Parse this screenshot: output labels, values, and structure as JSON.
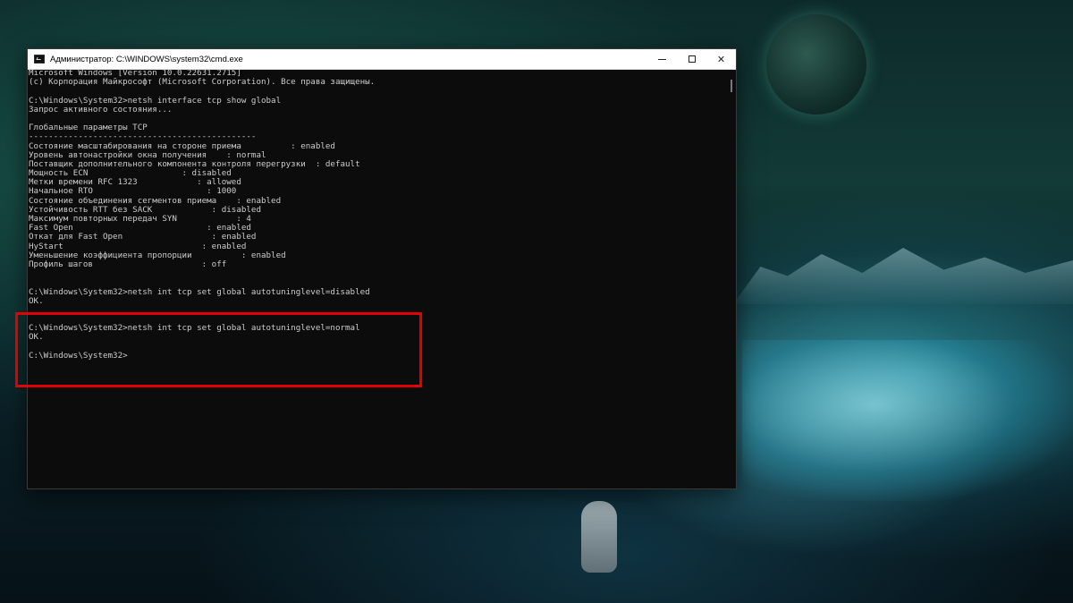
{
  "window": {
    "title": "Администратор: C:\\WINDOWS\\system32\\cmd.exe",
    "controls": {
      "minimize": "minimize",
      "maximize": "maximize",
      "close": "✕"
    }
  },
  "console": {
    "lines": [
      "Microsoft Windows [Version 10.0.22631.2715]",
      "(c) Корпорация Майкрософт (Microsoft Corporation). Все права защищены.",
      "",
      "C:\\Windows\\System32>netsh interface tcp show global",
      "Запрос активного состояния...",
      "",
      "Глобальные параметры TCP",
      "----------------------------------------------",
      "Состояние масштабирования на стороне приема          : enabled",
      "Уровень автонастройки окна получения    : normal",
      "Поставщик дополнительного компонента контроля перегрузки  : default",
      "Мощность ECN                   : disabled",
      "Метки времени RFC 1323            : allowed",
      "Начальное RTO                       : 1000",
      "Состояние объединения сегментов приема    : enabled",
      "Устойчивость RTT без SACK            : disabled",
      "Максимум повторных передач SYN            : 4",
      "Fast Open                           : enabled",
      "Откат для Fast Open                  : enabled",
      "HyStart                            : enabled",
      "Уменьшение коэффициента пропорции          : enabled",
      "Профиль шагов                      : off",
      "",
      "",
      "C:\\Windows\\System32>netsh int tcp set global autotuninglevel=disabled",
      "OK.",
      "",
      "",
      "C:\\Windows\\System32>netsh int tcp set global autotuninglevel=normal",
      "OK.",
      "",
      "C:\\Windows\\System32>"
    ]
  },
  "colors": {
    "highlight": "#e00000",
    "console_bg": "#0c0c0c",
    "console_text": "#cccccc"
  }
}
